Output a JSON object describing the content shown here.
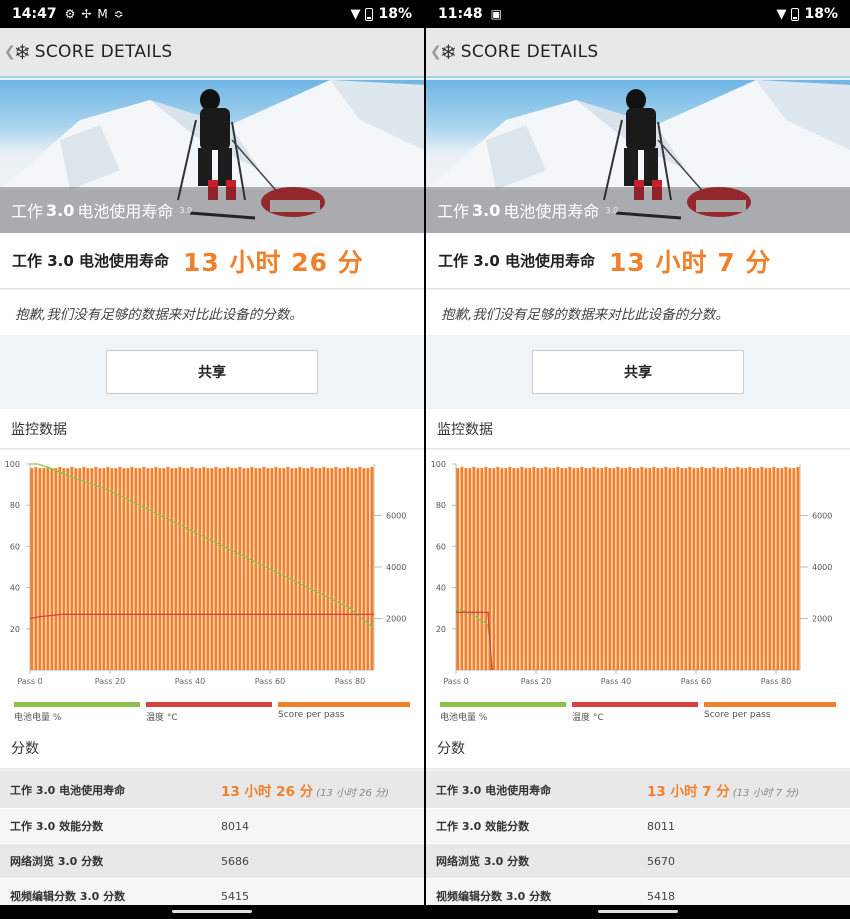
{
  "colors": {
    "accent": "#f0802a",
    "battery_line": "#8bc34a",
    "temp_line": "#d94040",
    "score_bar": "#f0802a"
  },
  "panels": [
    {
      "status": {
        "time": "14:47",
        "icons": [
          "gear-icon",
          "fan-icon",
          "gmail-icon",
          "signal-icon"
        ],
        "battery": "18%"
      },
      "header": {
        "title": "SCORE DETAILS"
      },
      "hero": {
        "caption_pre": "工作",
        "caption_bold": "3.0",
        "caption_post": "电池使用寿命",
        "caption_ver": "3.0"
      },
      "result": {
        "label": "工作 3.0 电池使用寿命",
        "value": "13 小时 26 分"
      },
      "notice": "抱歉,我们没有足够的数据来对比此设备的分数。",
      "share_label": "共享",
      "monitor_title": "监控数据",
      "legend": [
        "电池电量 %",
        "温度 °C",
        "Score per pass"
      ],
      "scores_title": "分数",
      "scores": [
        {
          "name": "工作 3.0 电池使用寿命",
          "value": "13 小时 26 分",
          "paren": "(13 小时 26 分)"
        },
        {
          "name": "工作 3.0 效能分数",
          "value": "8014"
        },
        {
          "name": "网络浏览 3.0 分数",
          "value": "5686"
        },
        {
          "name": "视频编辑分数 3.0 分数",
          "value": "5415"
        }
      ]
    },
    {
      "status": {
        "time": "11:48",
        "icons": [
          "cast-icon"
        ],
        "battery": "18%"
      },
      "header": {
        "title": "SCORE DETAILS"
      },
      "hero": {
        "caption_pre": "工作",
        "caption_bold": "3.0",
        "caption_post": "电池使用寿命",
        "caption_ver": "3.0"
      },
      "result": {
        "label": "工作 3.0 电池使用寿命",
        "value": "13 小时 7 分"
      },
      "notice": "抱歉,我们没有足够的数据来对比此设备的分数。",
      "share_label": "共享",
      "monitor_title": "监控数据",
      "legend": [
        "电池电量 %",
        "温度 °C",
        "Score per pass"
      ],
      "scores_title": "分数",
      "scores": [
        {
          "name": "工作 3.0 电池使用寿命",
          "value": "13 小时 7 分",
          "paren": "(13 小时 7 分)"
        },
        {
          "name": "工作 3.0 效能分数",
          "value": "8011"
        },
        {
          "name": "网络浏览 3.0 分数",
          "value": "5670"
        },
        {
          "name": "视频编辑分数 3.0 分数",
          "value": "5418"
        }
      ]
    }
  ],
  "chart_data": [
    {
      "type": "bar",
      "x_tick_labels": [
        "Pass 0",
        "Pass 20",
        "Pass 40",
        "Pass 60",
        "Pass 80"
      ],
      "x_range": [
        0,
        86
      ],
      "left_axis_ticks": [
        "20",
        "40",
        "60",
        "80",
        "100"
      ],
      "left_range": [
        0,
        100
      ],
      "right_axis_ticks": [
        "2000",
        "4000",
        "6000"
      ],
      "right_range": [
        0,
        8000
      ],
      "series": [
        {
          "name": "Score per pass",
          "axis": "left",
          "bar_count": 86,
          "value": 98
        },
        {
          "name": "电池电量 %",
          "axis": "left",
          "points": [
            [
              0,
              100
            ],
            [
              2,
              100
            ],
            [
              5,
              98
            ],
            [
              10,
              94
            ],
            [
              20,
              87
            ],
            [
              40,
              68
            ],
            [
              60,
              49
            ],
            [
              80,
              30
            ],
            [
              86,
              20
            ]
          ]
        },
        {
          "name": "温度 °C",
          "axis": "left",
          "points": [
            [
              0,
              25
            ],
            [
              3,
              26
            ],
            [
              8,
              27
            ],
            [
              86,
              27
            ]
          ]
        }
      ]
    },
    {
      "type": "bar",
      "x_tick_labels": [
        "Pass 0",
        "Pass 20",
        "Pass 40",
        "Pass 60",
        "Pass 80"
      ],
      "x_range": [
        0,
        86
      ],
      "left_axis_ticks": [
        "20",
        "40",
        "60",
        "80",
        "100"
      ],
      "left_range": [
        0,
        100
      ],
      "right_axis_ticks": [
        "2000",
        "4000",
        "6000"
      ],
      "right_range": [
        0,
        8000
      ],
      "series": [
        {
          "name": "Score per pass",
          "axis": "left",
          "bar_count": 86,
          "value": 98
        },
        {
          "name": "电池电量 %",
          "axis": "left",
          "points": [
            [
              0,
              30
            ],
            [
              4,
              27
            ],
            [
              8,
              22
            ],
            [
              9,
              0
            ]
          ]
        },
        {
          "name": "温度 °C",
          "axis": "left",
          "points": [
            [
              0,
              28
            ],
            [
              8,
              28
            ],
            [
              9,
              0
            ]
          ]
        }
      ]
    }
  ]
}
